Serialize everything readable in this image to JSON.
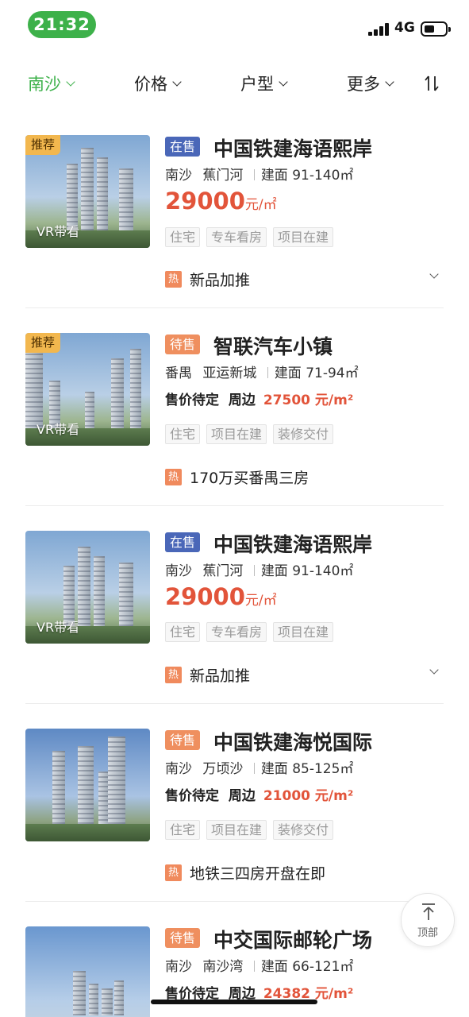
{
  "status_bar": {
    "time": "21:32",
    "network": "4G"
  },
  "filters": [
    {
      "label": "南沙",
      "active": true
    },
    {
      "label": "价格",
      "active": false
    },
    {
      "label": "户型",
      "active": false
    },
    {
      "label": "更多",
      "active": false
    }
  ],
  "listings": [
    {
      "badge": "推荐",
      "vr": "VR带看",
      "status": "在售",
      "status_kind": "onsale",
      "title": "中国铁建海语熙岸",
      "district": "南沙",
      "area": "蕉门河",
      "size": "建面 91-140㎡",
      "price": "29000",
      "price_unit": "元/㎡",
      "tags": [
        "住宅",
        "专车看房",
        "项目在建"
      ],
      "hot_icon": "热",
      "hot_text": "新品加推",
      "expandable": true
    },
    {
      "badge": "推荐",
      "vr": "VR带看",
      "status": "待售",
      "status_kind": "pending",
      "title": "智联汽车小镇",
      "district": "番禺",
      "area": "亚运新城",
      "size": "建面 71-94㎡",
      "price_status": "售价待定",
      "nearby_label": "周边",
      "nearby_price": "27500 元/m²",
      "tags": [
        "住宅",
        "项目在建",
        "装修交付"
      ],
      "hot_icon": "热",
      "hot_text": "170万买番禺三房",
      "expandable": false
    },
    {
      "badge": "",
      "vr": "VR带看",
      "status": "在售",
      "status_kind": "onsale",
      "title": "中国铁建海语熙岸",
      "district": "南沙",
      "area": "蕉门河",
      "size": "建面 91-140㎡",
      "price": "29000",
      "price_unit": "元/㎡",
      "tags": [
        "住宅",
        "专车看房",
        "项目在建"
      ],
      "hot_icon": "热",
      "hot_text": "新品加推",
      "expandable": true
    },
    {
      "badge": "",
      "vr": "",
      "status": "待售",
      "status_kind": "pending",
      "title": "中国铁建海悦国际",
      "district": "南沙",
      "area": "万顷沙",
      "size": "建面 85-125㎡",
      "price_status": "售价待定",
      "nearby_label": "周边",
      "nearby_price": "21000 元/m²",
      "tags": [
        "住宅",
        "项目在建",
        "装修交付"
      ],
      "hot_icon": "热",
      "hot_text": "地铁三四房开盘在即",
      "expandable": false
    },
    {
      "badge": "",
      "vr": "",
      "status": "待售",
      "status_kind": "pending",
      "title": "中交国际邮轮广场",
      "district": "南沙",
      "area": "南沙湾",
      "size": "建面 66-121㎡",
      "price_status": "售价待定",
      "nearby_label": "周边",
      "nearby_price": "24382 元/m²",
      "tags": [],
      "hot_icon": "",
      "hot_text": "",
      "expandable": false
    }
  ],
  "back_to_top": {
    "label": "顶部"
  },
  "colors": {
    "accent_green": "#3db14a",
    "price_red": "#e2543a",
    "onsale_blue": "#4a67b8",
    "pending_orange": "#ef8f5f",
    "badge_yellow": "#f2b74e"
  }
}
